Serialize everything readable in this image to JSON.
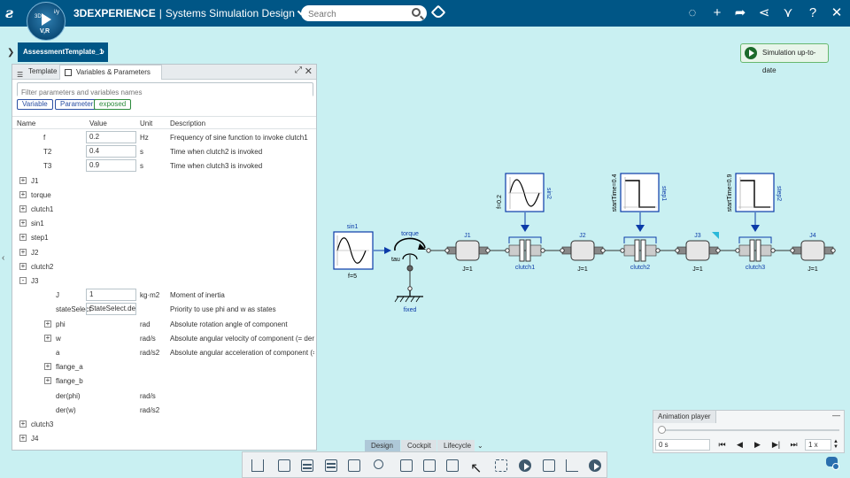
{
  "header": {
    "brand_bold": "3DEXPERIENCE",
    "separator": "|",
    "app_name": "Systems Simulation Design",
    "compass_top": "3D",
    "compass_bottom": "V,R",
    "compass_right": "i/y",
    "search_placeholder": "Search"
  },
  "breadcrumb": {
    "label": "AssessmentTemplate_1"
  },
  "simulation_status": {
    "label": "Simulation up-to-date"
  },
  "panel": {
    "tabs": [
      {
        "label": "Template"
      },
      {
        "label": "Variables & Parameters"
      }
    ],
    "filter_placeholder": "Filter parameters and variables names",
    "chips": [
      {
        "label": "Variable"
      },
      {
        "label": "Parameter"
      },
      {
        "label": "exposed"
      }
    ],
    "columns": {
      "name": "Name",
      "value": "Value",
      "unit": "Unit",
      "description": "Description"
    },
    "rows": [
      {
        "name": "f",
        "value": "0.2",
        "unit": "Hz",
        "description": "Frequency of sine function to invoke clutch1"
      },
      {
        "name": "T2",
        "value": "0.4",
        "unit": "s",
        "description": "Time when clutch2 is invoked"
      },
      {
        "name": "T3",
        "value": "0.9",
        "unit": "s",
        "description": "Time when clutch3 is invoked"
      },
      {
        "name": "J1",
        "toggle": "+"
      },
      {
        "name": "torque",
        "toggle": "+"
      },
      {
        "name": "clutch1",
        "toggle": "+"
      },
      {
        "name": "sin1",
        "toggle": "+"
      },
      {
        "name": "step1",
        "toggle": "+"
      },
      {
        "name": "J2",
        "toggle": "+"
      },
      {
        "name": "clutch2",
        "toggle": "+"
      },
      {
        "name": "J3",
        "toggle": "-"
      },
      {
        "name": "J",
        "value": "1",
        "unit": "kg·m2",
        "description": "Moment of inertia"
      },
      {
        "name": "stateSelect",
        "value": "StateSelect.de",
        "unit": "",
        "description": "Priority to use phi and w as states"
      },
      {
        "name": "phi",
        "toggle": "+",
        "unit": "rad",
        "description": "Absolute rotation angle of component"
      },
      {
        "name": "w",
        "toggle": "+",
        "unit": "rad/s",
        "description": "Absolute angular velocity of component (= der(p..."
      },
      {
        "name": "a",
        "unit": "rad/s2",
        "description": "Absolute angular acceleration of component (= ..."
      },
      {
        "name": "flange_a",
        "toggle": "+"
      },
      {
        "name": "flange_b",
        "toggle": "+"
      },
      {
        "name": "der(phi)",
        "unit": "rad/s"
      },
      {
        "name": "der(w)",
        "unit": "rad/s2"
      },
      {
        "name": "clutch3",
        "toggle": "+"
      },
      {
        "name": "J4",
        "toggle": "+"
      }
    ]
  },
  "diagram": {
    "sin1": {
      "name": "sin1",
      "param": "f=5"
    },
    "torque": {
      "name": "torque",
      "input": "tau"
    },
    "fixed": {
      "name": "fixed"
    },
    "J1": {
      "name": "J1",
      "param": "J=1"
    },
    "sin2": {
      "name": "sin2",
      "param": "f=0.2"
    },
    "clutch1": {
      "name": "clutch1"
    },
    "J2": {
      "name": "J2",
      "param": "J=1"
    },
    "step1": {
      "name": "step1",
      "param": "startTime=0.4"
    },
    "clutch2": {
      "name": "clutch2"
    },
    "J3": {
      "name": "J3",
      "param": "J=1"
    },
    "step2": {
      "name": "step2",
      "param": "startTime=0.9"
    },
    "clutch3": {
      "name": "clutch3"
    },
    "J4": {
      "name": "J4",
      "param": "J=1"
    }
  },
  "modes": [
    {
      "label": "Design"
    },
    {
      "label": "Cockpit"
    },
    {
      "label": "Lifecycle"
    }
  ],
  "animation_player": {
    "title": "Animation player",
    "time": "0 s",
    "speed": "1 x",
    "progress": 0
  },
  "colors": {
    "topbar": "#005686",
    "canvas": "#c9f0f2",
    "diagram_blue": "#0b3ba8"
  }
}
